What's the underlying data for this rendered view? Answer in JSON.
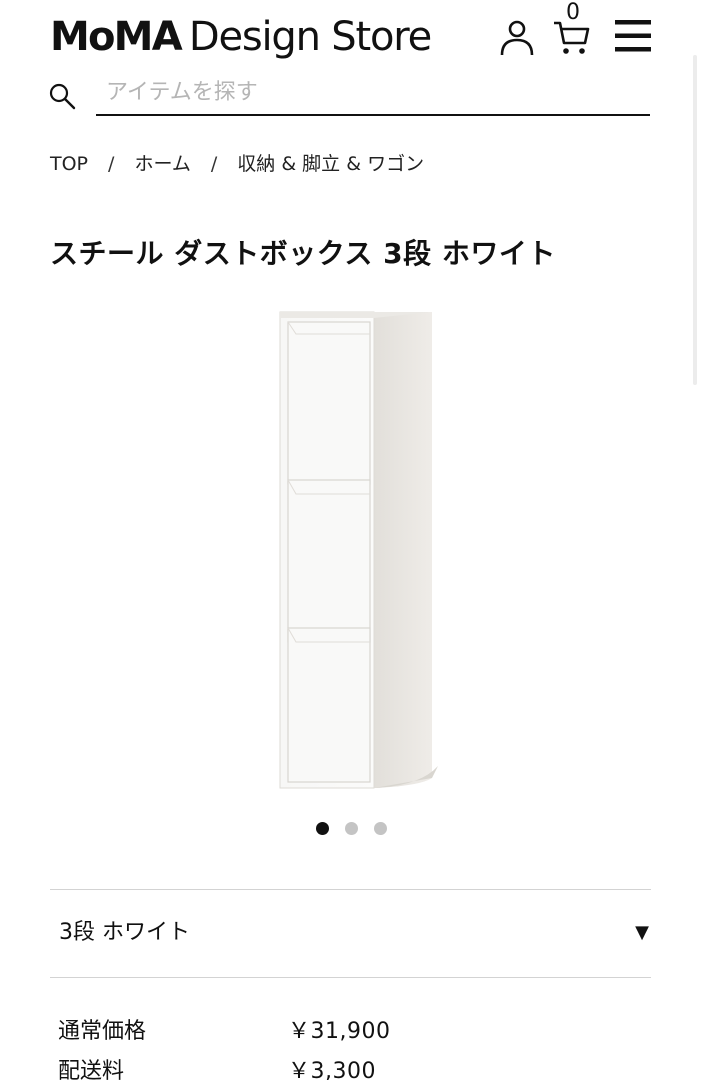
{
  "header": {
    "logo_bold": "MoMA",
    "logo_light": "Design Store",
    "cart_count": "0",
    "user_icon": "user-icon",
    "cart_icon": "cart-icon",
    "menu_icon": "hamburger-menu-icon"
  },
  "search": {
    "placeholder": "アイテムを探す",
    "icon": "search-icon"
  },
  "breadcrumb": {
    "items": [
      "TOP",
      "ホーム",
      "収納 & 脚立 & ワゴン"
    ],
    "separator": "/"
  },
  "product": {
    "title": "スチール ダストボックス 3段 ホワイト",
    "image_count": 3,
    "active_image_index": 0
  },
  "variant": {
    "selected": "3段 ホワイト",
    "arrow": "▼"
  },
  "pricing": {
    "regular_label": "通常価格",
    "regular_value": "￥31,900",
    "shipping_label": "配送料",
    "shipping_value": "￥3,300"
  }
}
